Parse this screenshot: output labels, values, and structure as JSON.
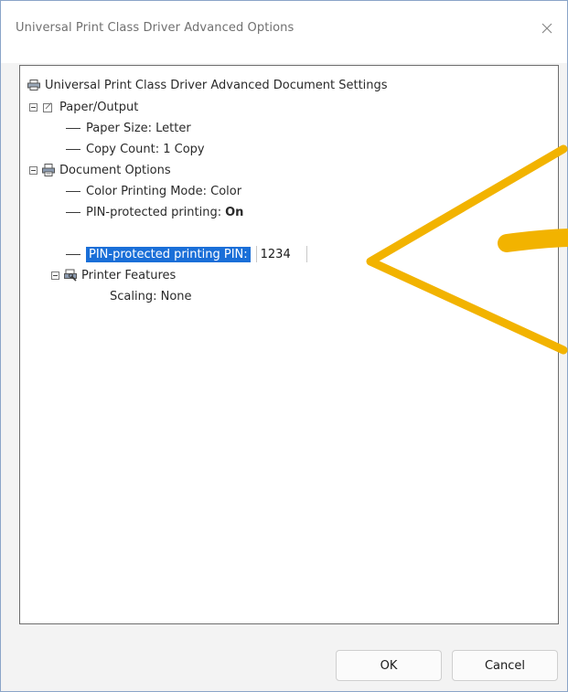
{
  "window": {
    "title": "Universal Print Class Driver Advanced Options"
  },
  "tree": {
    "root": "Universal Print Class Driver Advanced Document Settings",
    "paper_output": {
      "label": "Paper/Output",
      "paper_size": "Paper Size: Letter",
      "copy_count": "Copy Count: 1 Copy"
    },
    "document_options": {
      "label": "Document Options",
      "color_mode": "Color Printing Mode: Color",
      "pin_printing_label": "PIN-protected printing:",
      "pin_printing_value": "On",
      "pin_label": "PIN-protected printing PIN:",
      "pin_value": "1234"
    },
    "printer_features": {
      "label": "Printer Features",
      "scaling": "Scaling: None"
    }
  },
  "buttons": {
    "ok": "OK",
    "cancel": "Cancel"
  },
  "colors": {
    "selection": "#1a6fd8",
    "annotation_arrow": "#f2b300"
  },
  "icons": {
    "close": "close-icon",
    "printer": "printer-icon",
    "paper": "paper-icon",
    "document_options": "document-options-icon",
    "printer_features": "printer-features-icon"
  }
}
